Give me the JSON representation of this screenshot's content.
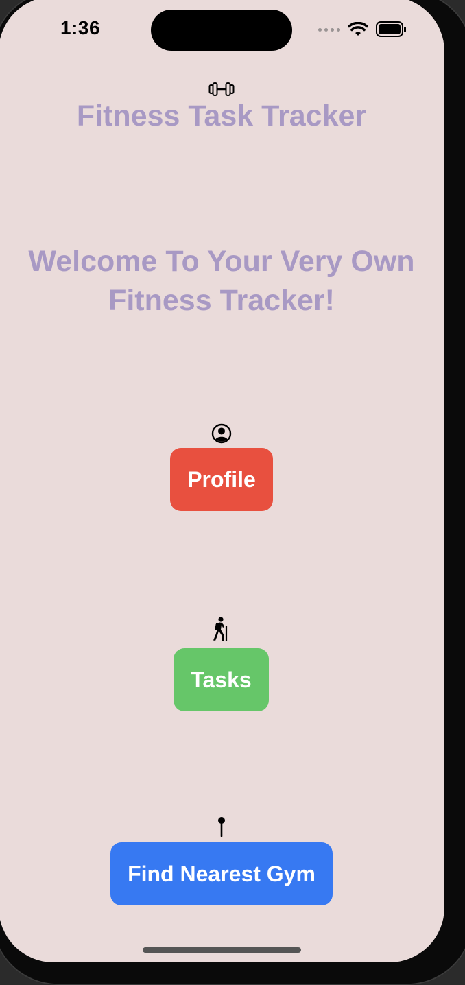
{
  "status_bar": {
    "time": "1:36"
  },
  "header": {
    "icon": "dumbbell-icon",
    "title": "Fitness Task Tracker"
  },
  "welcome": {
    "line1": "Welcome To Your Very Own",
    "line2": "Fitness Tracker!"
  },
  "buttons": {
    "profile": {
      "label": "Profile",
      "icon": "person-circle-icon",
      "color": "#e8503f"
    },
    "tasks": {
      "label": "Tasks",
      "icon": "hiker-icon",
      "color": "#66c669"
    },
    "gym": {
      "label": "Find Nearest Gym",
      "icon": "pin-icon",
      "color": "#3779f2"
    }
  },
  "colors": {
    "background": "#eadbda",
    "title_text": "#a899c4"
  }
}
